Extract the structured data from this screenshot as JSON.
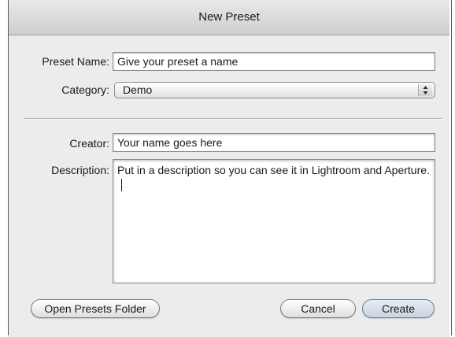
{
  "dialog": {
    "title": "New Preset"
  },
  "form": {
    "preset_name_label": "Preset Name:",
    "preset_name_value": "Give your preset a name",
    "category_label": "Category:",
    "category_value": "Demo",
    "creator_label": "Creator:",
    "creator_value": "Your name goes here",
    "description_label": "Description:",
    "description_value": "Put in a description so you can see it in Lightroom and Aperture."
  },
  "buttons": {
    "open_presets_folder": "Open Presets Folder",
    "cancel": "Cancel",
    "create": "Create"
  },
  "icons": {
    "category_select": "up-down-arrows-icon"
  }
}
